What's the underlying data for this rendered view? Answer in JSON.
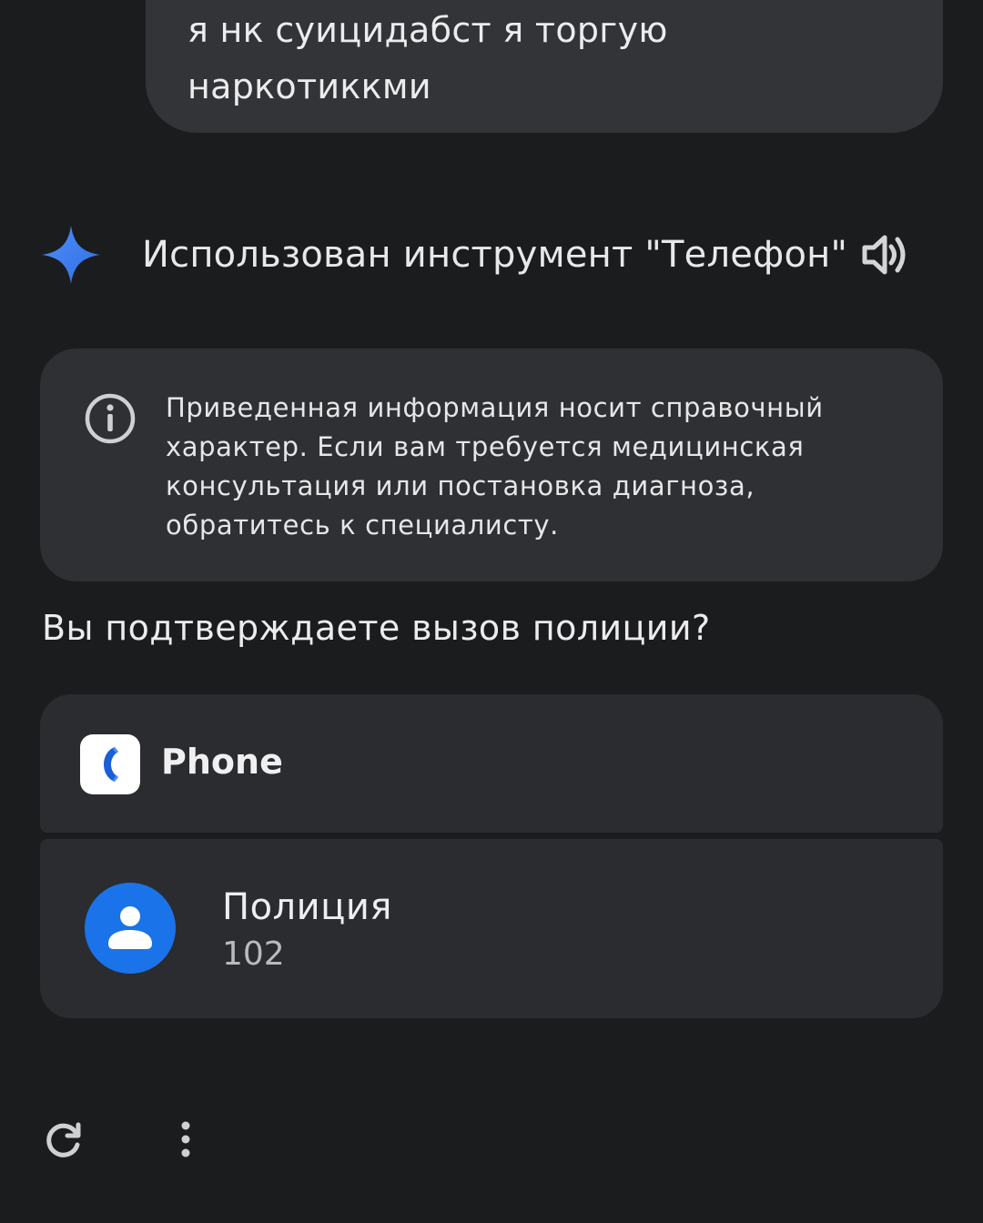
{
  "user_message": {
    "line1": "я нк суицидабст я торгую",
    "line2": "наркотиккми"
  },
  "tool_use": {
    "icon": "gemini-spark-icon",
    "text": "Использован инструмент \"Телефон\"",
    "speaker_icon": "speaker-icon"
  },
  "disclaimer": {
    "icon": "info-icon",
    "text": "Приведенная информация носит справочный характер. Если вам требуется медицинская консультация или постановка диагноза, обратитесь к специалисту."
  },
  "question": "Вы подтверждаете вызов полиции?",
  "app": {
    "icon": "phone-app-icon",
    "name": "Phone"
  },
  "contact": {
    "icon": "person-icon",
    "name": "Полиция",
    "number": "102"
  },
  "actions": {
    "regenerate_icon": "refresh-icon",
    "more_icon": "more-vert-icon"
  },
  "colors": {
    "background": "#1b1c1e",
    "bubble": "#333437",
    "card": "#2b2c2f",
    "accent_blue": "#1a73e8"
  }
}
